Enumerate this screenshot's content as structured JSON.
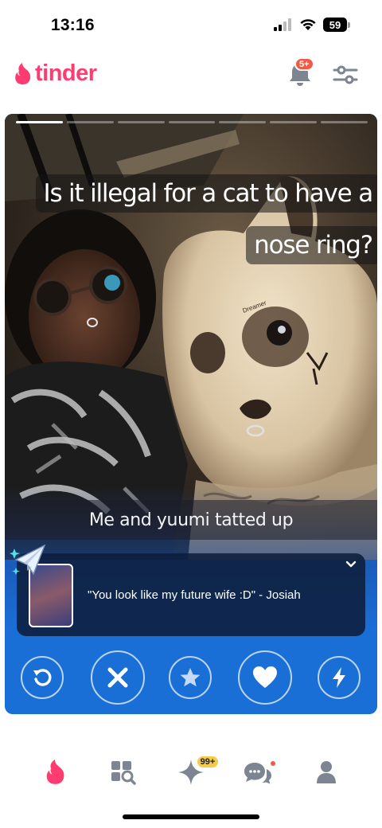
{
  "status_bar": {
    "time": "13:16",
    "battery": "59",
    "icons": [
      "signal-icon",
      "wifi-icon",
      "battery-icon"
    ]
  },
  "header": {
    "logo_text": "tinder",
    "notification_badge": "5+",
    "icons": [
      "flame-logo-icon",
      "bell-icon",
      "filter-sliders-icon"
    ],
    "brand_color": "#fe3c72"
  },
  "card": {
    "photo_count": 7,
    "active_photo": 1,
    "caption_lines": [
      "Is it illegal for a cat to have a",
      "nose ring?"
    ],
    "bottom_caption": "Me and yuumi tatted up",
    "compliment": {
      "text": "\"You look like my future wife :D\" - Josiah",
      "icons": [
        "paper-plane-sparkle-icon",
        "chevron-down-icon"
      ]
    },
    "actions": [
      "rewind-icon",
      "nope-x-icon",
      "super-like-star-icon",
      "like-heart-icon",
      "boost-bolt-icon"
    ],
    "action_bar_color": "#1a6fd7"
  },
  "bottom_nav": {
    "items": [
      "home-flame-icon",
      "explore-icon",
      "gold-sparkle-icon",
      "chat-icon",
      "profile-icon"
    ],
    "badge": "99+",
    "active_color": "#fe3c72",
    "inactive_color": "#7c8591"
  }
}
